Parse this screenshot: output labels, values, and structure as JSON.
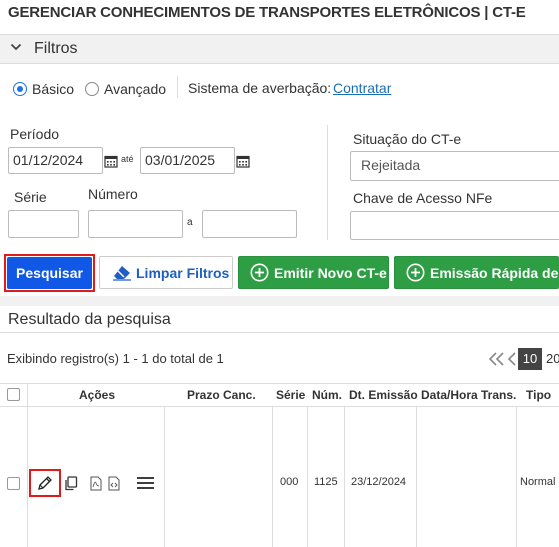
{
  "page": {
    "title": "GERENCIAR CONHECIMENTOS DE TRANSPORTES ELETRÔNICOS | CT-E"
  },
  "filters": {
    "header_label": "Filtros",
    "mode_basic": "Básico",
    "mode_advanced": "Avançado",
    "selected_mode": "Básico",
    "averbacao_label": "Sistema de averbação:",
    "averbacao_link": "Contratar",
    "periodo_label": "Período",
    "date_from": "01/12/2024",
    "date_to_sep": "até",
    "date_to": "03/01/2025",
    "serie_label": "Série",
    "serie_value": "",
    "numero_label": "Número",
    "numero_from": "",
    "numero_sep": "a",
    "numero_to": "",
    "situacao_label": "Situação do CT-e",
    "situacao_value": "Rejeitada",
    "chave_label": "Chave de Acesso NFe",
    "chave_value": ""
  },
  "actions": {
    "pesquisar": "Pesquisar",
    "limpar": "Limpar Filtros",
    "emitir": "Emitir Novo CT-e",
    "emissao_rapida": "Emissão Rápida de C"
  },
  "results": {
    "title": "Resultado da pesquisa",
    "summary": "Exibindo registro(s) 1 - 1 do total de 1",
    "page_size_selected": "10",
    "page_size_next": "20",
    "columns": [
      "Ações",
      "Prazo Canc.",
      "Série",
      "Núm.",
      "Dt. Emissão",
      "Data/Hora Trans.",
      "Tipo"
    ],
    "rows": [
      {
        "prazo": "",
        "serie": "000",
        "numero": "1125",
        "emissao": "23/12/2024",
        "transmissao": "",
        "tipo": "Normal"
      }
    ]
  },
  "colors": {
    "primary_blue": "#1258e6",
    "success_green": "#2e9e45",
    "highlight_red": "#e01b1b",
    "link_blue": "#1a6fb5"
  }
}
